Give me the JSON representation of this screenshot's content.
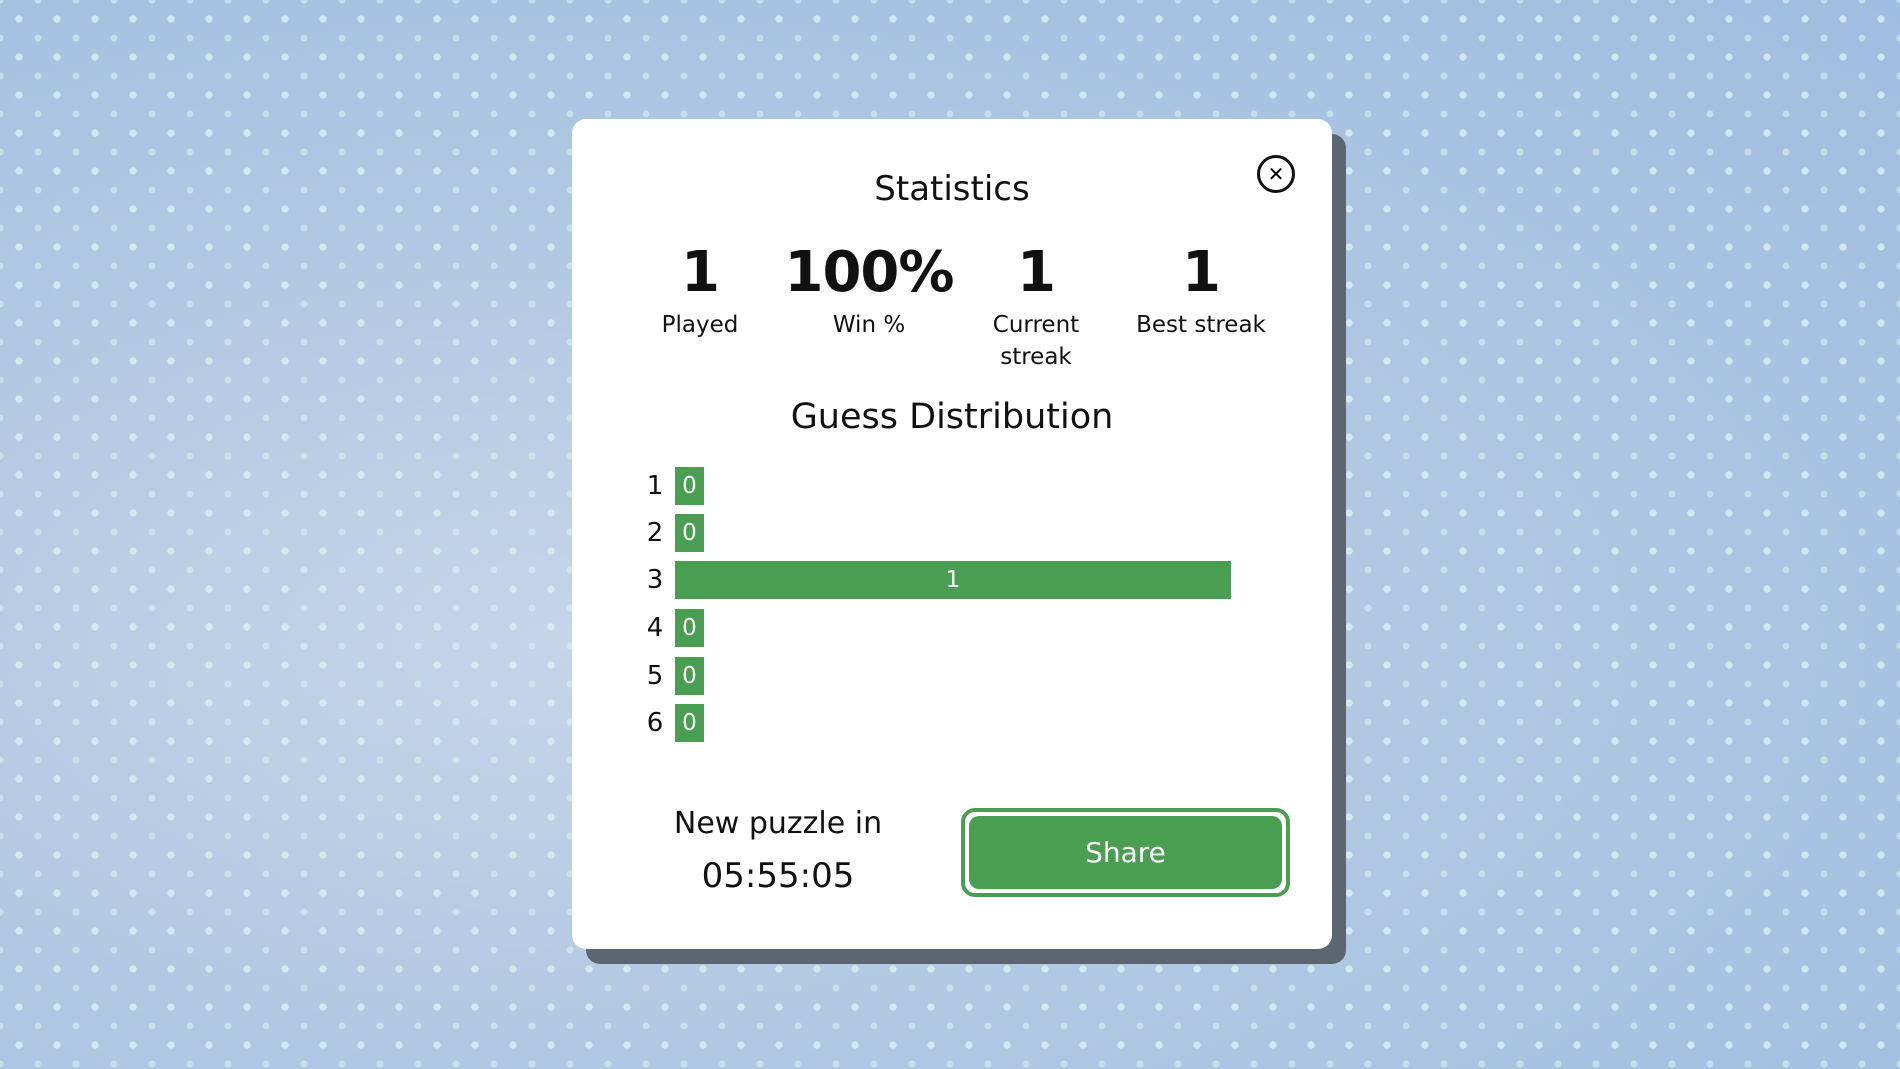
{
  "modal": {
    "title": "Statistics",
    "close_icon": "close-circle-icon",
    "stats": [
      {
        "value": "1",
        "label": "Played"
      },
      {
        "value": "100%",
        "label": "Win %"
      },
      {
        "value": "1",
        "label_line1": "Current",
        "label_line2": "streak"
      },
      {
        "value": "1",
        "label": "Best streak"
      }
    ],
    "distribution_title": "Guess Distribution",
    "distribution": [
      {
        "guess": "1",
        "count": 0
      },
      {
        "guess": "2",
        "count": 0
      },
      {
        "guess": "3",
        "count": 1
      },
      {
        "guess": "4",
        "count": 0
      },
      {
        "guess": "5",
        "count": 0
      },
      {
        "guess": "6",
        "count": 0
      }
    ],
    "countdown_label": "New puzzle in",
    "countdown_time": "05:55:05",
    "share_label": "Share",
    "accent_color": "#4a9e52"
  }
}
